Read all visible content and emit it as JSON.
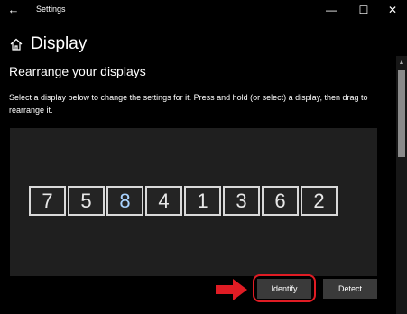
{
  "window": {
    "title": "Settings",
    "back_icon": "arrow-left-icon",
    "min_icon": "minimize-icon",
    "max_icon": "maximize-icon",
    "close_icon": "close-icon"
  },
  "header": {
    "icon": "home-icon",
    "title": "Display"
  },
  "section": {
    "title": "Rearrange your displays",
    "description": "Select a display below to change the settings for it. Press and hold (or select) a display, then drag to rearrange it."
  },
  "displays": [
    {
      "label": "7",
      "selected": false
    },
    {
      "label": "5",
      "selected": false
    },
    {
      "label": "8",
      "selected": true
    },
    {
      "label": "4",
      "selected": false
    },
    {
      "label": "1",
      "selected": false
    },
    {
      "label": "3",
      "selected": false
    },
    {
      "label": "6",
      "selected": false
    },
    {
      "label": "2",
      "selected": false
    }
  ],
  "buttons": {
    "identify": "Identify",
    "detect": "Detect"
  },
  "colors": {
    "background": "#000000",
    "panel": "#1f1f1f",
    "button": "#3a3a3a",
    "highlight": "#e01c24",
    "selected_text": "#a9d3ff"
  }
}
